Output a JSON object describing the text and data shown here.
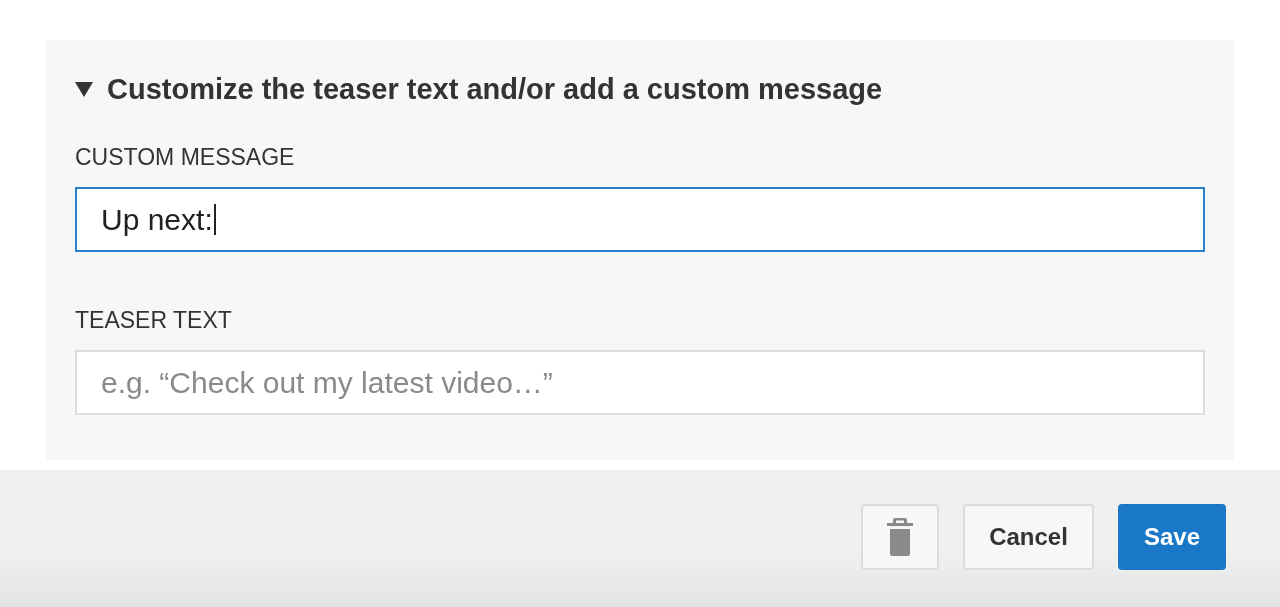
{
  "section": {
    "title": "Customize the teaser text and/or add a custom message",
    "expanded": true
  },
  "fields": [
    {
      "label": "CUSTOM MESSAGE",
      "value": "Up next:",
      "focused": true
    },
    {
      "label": "TEASER TEXT",
      "placeholder": "e.g. “Check out my latest video…”",
      "focused": false
    }
  ],
  "footer": {
    "buttons": [
      {
        "kind": "delete"
      },
      {
        "kind": "secondary",
        "label": "Cancel"
      },
      {
        "kind": "primary",
        "label": "Save"
      }
    ]
  }
}
